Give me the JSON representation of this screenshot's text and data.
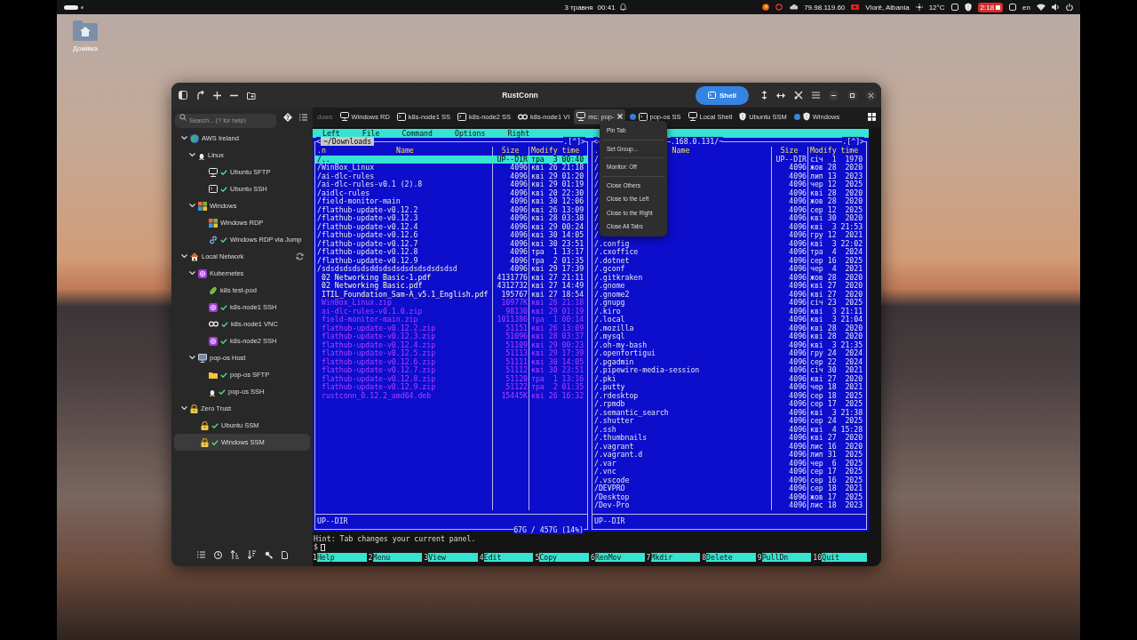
{
  "top_bar": {
    "date": "3 травня",
    "time": "00:41",
    "ip": "79.98.119.60",
    "location": "Vlorë, Albania",
    "temperature": "12°C",
    "badge": "2:18",
    "language": "en"
  },
  "desktop_icons": [
    {
      "label": "Домівка"
    }
  ],
  "window": {
    "title": "RustConn",
    "shell_button": "Shell"
  },
  "sidebar": {
    "search": {
      "placeholder": "Search... (? for help)"
    },
    "tree": [
      {
        "label": "AWS Ireland",
        "kind": "globe",
        "expanded": true,
        "sync": false,
        "selected": false,
        "children": [
          {
            "label": "Linux",
            "kind": "linux",
            "expanded": true,
            "selected": false,
            "children": [
              {
                "label": "Ubuntu SFTP",
                "kind": "sftp",
                "connected": true,
                "selected": false
              },
              {
                "label": "Ubuntu SSH",
                "kind": "ssh",
                "connected": true,
                "selected": false
              }
            ]
          },
          {
            "label": "Windows",
            "kind": "windows",
            "expanded": true,
            "selected": false,
            "children": [
              {
                "label": "Windows RDP",
                "kind": "windows",
                "connected": false,
                "selected": false
              },
              {
                "label": "Windows RDP via Jump",
                "kind": "link",
                "connected": true,
                "selected": false
              }
            ]
          }
        ]
      },
      {
        "label": "Local Network",
        "kind": "house",
        "expanded": true,
        "sync": true,
        "selected": false,
        "children": [
          {
            "label": "Kubernetes",
            "kind": "kube",
            "expanded": true,
            "selected": false,
            "children": [
              {
                "label": "k8s test-pod",
                "kind": "pod",
                "connected": false,
                "selected": false
              },
              {
                "label": "k8s-node1 SSH",
                "kind": "kube",
                "connected": true,
                "selected": false
              },
              {
                "label": "k8s-node1 VNC",
                "kind": "vnc",
                "connected": true,
                "selected": false
              },
              {
                "label": "k8s-node2 SSH",
                "kind": "kube",
                "connected": true,
                "selected": false
              }
            ]
          },
          {
            "label": "pop-os Host",
            "kind": "monitor",
            "expanded": true,
            "selected": false,
            "children": [
              {
                "label": "pop-os SFTP",
                "kind": "folder",
                "connected": true,
                "selected": false
              },
              {
                "label": "pop-os SSH",
                "kind": "linux",
                "connected": true,
                "selected": false
              }
            ]
          }
        ]
      },
      {
        "label": "Zero Trust",
        "kind": "lock",
        "expanded": true,
        "sync": false,
        "selected": false,
        "children": [
          {
            "label": "Ubuntu SSM",
            "kind": "lock",
            "connected": true,
            "selected": false
          },
          {
            "label": "Windows SSM",
            "kind": "lock",
            "connected": true,
            "selected": true
          }
        ]
      }
    ]
  },
  "tabs": [
    {
      "label": "dows",
      "kind": "none",
      "dot": false,
      "selected": false
    },
    {
      "label": "Windows RD",
      "kind": "rdp",
      "dot": false,
      "selected": false
    },
    {
      "label": "k8s-node1 SS",
      "kind": "ssh",
      "dot": false,
      "selected": false
    },
    {
      "label": "k8s-node2 SS",
      "kind": "ssh",
      "dot": false,
      "selected": false
    },
    {
      "label": "k8s-node1 VI",
      "kind": "vnc",
      "dot": false,
      "selected": false
    },
    {
      "label": "mc: pop-",
      "kind": "sftp",
      "dot": false,
      "selected": true
    },
    {
      "label": "pop-os SS",
      "kind": "ssh",
      "dot": true,
      "selected": false
    },
    {
      "label": "Local Shell",
      "kind": "sftp",
      "dot": false,
      "selected": false
    },
    {
      "label": "Ubuntu SSM",
      "kind": "ssm",
      "dot": false,
      "selected": false
    },
    {
      "label": "Windows",
      "kind": "ssm",
      "dot": true,
      "selected": false
    }
  ],
  "tab_menu": {
    "groups": [
      [
        "Pin Tab"
      ],
      [
        "Set Group..."
      ],
      [
        "Monitor: Off"
      ],
      [
        "Close Others",
        "Close to the Left",
        "Close to the Right",
        "Close All Tabs"
      ]
    ]
  },
  "terminal": {
    "menu": [
      "Left",
      "File",
      "Command",
      "Options",
      "Right"
    ],
    "panels": [
      {
        "active": true,
        "left_mark": "<",
        "path": "~/Downloads",
        "right_mark": ".[^]>",
        "columns": [
          ".n",
          "Name",
          "Size",
          "Modify time"
        ],
        "mini_status": "UP--DIR",
        "disk": "67G / 457G (14%)",
        "rows": [
          {
            "name": "/..",
            "size": "UP--DIR",
            "time": "тра  3 00:40",
            "kind": "dir",
            "selected": true
          },
          {
            "name": "/WinBox_Linux",
            "size": "4096",
            "time": "кві 26 21:18",
            "kind": "dir",
            "selected": false
          },
          {
            "name": "/ai-dlc-rules",
            "size": "4096",
            "time": "кві 29 01:20",
            "kind": "dir",
            "selected": false
          },
          {
            "name": "/ai-dlc-rules-v0.1 (2).8",
            "size": "4096",
            "time": "кві 29 01:19",
            "kind": "dir",
            "selected": false
          },
          {
            "name": "/aidlc-rules",
            "size": "4096",
            "time": "кві 20 22:30",
            "kind": "dir",
            "selected": false
          },
          {
            "name": "/field-monitor-main",
            "size": "4096",
            "time": "кві 30 12:06",
            "kind": "dir",
            "selected": false
          },
          {
            "name": "/flathub-update-v0.12.2",
            "size": "4096",
            "time": "кві 26 13:09",
            "kind": "dir",
            "selected": false
          },
          {
            "name": "/flathub-update-v0.12.3",
            "size": "4096",
            "time": "кві 28 03:38",
            "kind": "dir",
            "selected": false
          },
          {
            "name": "/flathub-update-v0.12.4",
            "size": "4096",
            "time": "кві 29 00:24",
            "kind": "dir",
            "selected": false
          },
          {
            "name": "/flathub-update-v0.12.6",
            "size": "4096",
            "time": "кві 30 14:05",
            "kind": "dir",
            "selected": false
          },
          {
            "name": "/flathub-update-v0.12.7",
            "size": "4096",
            "time": "кві 30 23:51",
            "kind": "dir",
            "selected": false
          },
          {
            "name": "/flathub-update-v0.12.8",
            "size": "4096",
            "time": "тра  1 13:17",
            "kind": "dir",
            "selected": false
          },
          {
            "name": "/flathub-update-v0.12.9",
            "size": "4096",
            "time": "тра  2 01:35",
            "kind": "dir",
            "selected": false
          },
          {
            "name": "/sdsdsdsdsdsddsdsdsdsdsdsdsdsdsd",
            "size": "4096",
            "time": "кві 29 17:39",
            "kind": "dir",
            "selected": false
          },
          {
            "name": "02 Networking Basic-1.pdf",
            "size": "4131776",
            "time": "кві 27 21:11",
            "kind": "file",
            "selected": false
          },
          {
            "name": "02 Networking Basic.pdf",
            "size": "4312732",
            "time": "кві 27 14:49",
            "kind": "file",
            "selected": false
          },
          {
            "name": "ITIL_Foundation_Sam-A_v5.1_English.pdf",
            "size": "195767",
            "time": "кві 27 18:54",
            "kind": "file",
            "selected": false
          },
          {
            "name": "WinBox_Linux.zip",
            "size": "10977K",
            "time": "кві 26 21:18",
            "kind": "archive",
            "selected": false
          },
          {
            "name": "ai-dlc-rules-v0.1.0.zip",
            "size": "98130",
            "time": "кві 29 01:19",
            "kind": "archive",
            "selected": false
          },
          {
            "name": "field-monitor-main.zip",
            "size": "1011386",
            "time": "тра  1 00:14",
            "kind": "archive",
            "selected": false
          },
          {
            "name": "flathub-update-v0.12.2.zip",
            "size": "51151",
            "time": "кві 26 13:09",
            "kind": "archive",
            "selected": false
          },
          {
            "name": "flathub-update-v0.12.3.zip",
            "size": "51096",
            "time": "кві 28 03:37",
            "kind": "archive",
            "selected": false
          },
          {
            "name": "flathub-update-v0.12.4.zip",
            "size": "51109",
            "time": "кві 29 00:23",
            "kind": "archive",
            "selected": false
          },
          {
            "name": "flathub-update-v0.12.5.zip",
            "size": "51113",
            "time": "кві 29 17:39",
            "kind": "archive",
            "selected": false
          },
          {
            "name": "flathub-update-v0.12.6.zip",
            "size": "51111",
            "time": "кві 30 14:05",
            "kind": "archive",
            "selected": false
          },
          {
            "name": "flathub-update-v0.12.7.zip",
            "size": "51112",
            "time": "кві 30 23:51",
            "kind": "archive",
            "selected": false
          },
          {
            "name": "flathub-update-v0.12.8.zip",
            "size": "51120",
            "time": "тра  1 13:16",
            "kind": "archive",
            "selected": false
          },
          {
            "name": "flathub-update-v0.12.9.zip",
            "size": "51122",
            "time": "тра  2 01:35",
            "kind": "archive",
            "selected": false
          },
          {
            "name": "rustconn_0.12.2_amd64.deb",
            "size": "15445K",
            "time": "кві 26 16:32",
            "kind": "archive",
            "selected": false
          }
        ]
      },
      {
        "active": false,
        "left_mark": "<",
        "path": ".168.0.131/~",
        "right_mark": ".[^]>",
        "columns": [
          ".",
          "Name",
          "Size",
          "Modify time"
        ],
        "mini_status": "UP--DIR",
        "rows": [
          {
            "name": "/",
            "size": "UP--DIR",
            "time": "січ  1  1970",
            "kind": "dir",
            "selected": false
          },
          {
            "name": "/",
            "size": "4096",
            "time": "жов 28  2020",
            "kind": "dir",
            "selected": false
          },
          {
            "name": "/",
            "size": "4096",
            "time": "лип 13  2023",
            "kind": "dir",
            "selected": false
          },
          {
            "name": "/",
            "size": "4096",
            "time": "чер 12  2025",
            "kind": "dir",
            "selected": false
          },
          {
            "name": "/",
            "size": "4096",
            "time": "кві 28  2020",
            "kind": "dir",
            "selected": false
          },
          {
            "name": "/",
            "size": "4096",
            "time": "жов 28  2020",
            "kind": "dir",
            "selected": false
          },
          {
            "name": "/",
            "size": "4096",
            "time": "сер 12  2025",
            "kind": "dir",
            "selected": false
          },
          {
            "name": "/",
            "size": "4096",
            "time": "кві 30  2020",
            "kind": "dir",
            "selected": false
          },
          {
            "name": "/",
            "size": "4096",
            "time": "кві  3 21:53",
            "kind": "dir",
            "selected": false
          },
          {
            "name": "/",
            "size": "4096",
            "time": "гру 12  2021",
            "kind": "dir",
            "selected": false
          },
          {
            "name": "/.config",
            "size": "4096",
            "time": "кві  3 22:02",
            "kind": "dir",
            "selected": false
          },
          {
            "name": "/.cxoffice",
            "size": "4096",
            "time": "тра  4  2024",
            "kind": "dir",
            "selected": false
          },
          {
            "name": "/.dotnet",
            "size": "4096",
            "time": "сер 16  2025",
            "kind": "dir",
            "selected": false
          },
          {
            "name": "/.gconf",
            "size": "4096",
            "time": "чер  4  2021",
            "kind": "dir",
            "selected": false
          },
          {
            "name": "/.gitkraken",
            "size": "4096",
            "time": "жов 28  2020",
            "kind": "dir",
            "selected": false
          },
          {
            "name": "/.gnome",
            "size": "4096",
            "time": "кві 27  2020",
            "kind": "dir",
            "selected": false
          },
          {
            "name": "/.gnome2",
            "size": "4096",
            "time": "кві 27  2020",
            "kind": "dir",
            "selected": false
          },
          {
            "name": "/.gnupg",
            "size": "4096",
            "time": "січ 23  2025",
            "kind": "dir",
            "selected": false
          },
          {
            "name": "/.kiro",
            "size": "4096",
            "time": "кві  3 21:11",
            "kind": "dir",
            "selected": false
          },
          {
            "name": "/.local",
            "size": "4096",
            "time": "кві  3 21:04",
            "kind": "dir",
            "selected": false
          },
          {
            "name": "/.mozilla",
            "size": "4096",
            "time": "кві 28  2020",
            "kind": "dir",
            "selected": false
          },
          {
            "name": "/.mysql",
            "size": "4096",
            "time": "кві 28  2020",
            "kind": "dir",
            "selected": false
          },
          {
            "name": "/.oh-my-bash",
            "size": "4096",
            "time": "кві  3 21:35",
            "kind": "dir",
            "selected": false
          },
          {
            "name": "/.openfortigui",
            "size": "4096",
            "time": "гру 24  2024",
            "kind": "dir",
            "selected": false
          },
          {
            "name": "/.pgadmin",
            "size": "4096",
            "time": "сер 22  2024",
            "kind": "dir",
            "selected": false
          },
          {
            "name": "/.pipewire-media-session",
            "size": "4096",
            "time": "січ 30  2021",
            "kind": "dir",
            "selected": false
          },
          {
            "name": "/.pki",
            "size": "4096",
            "time": "кві 27  2020",
            "kind": "dir",
            "selected": false
          },
          {
            "name": "/.putty",
            "size": "4096",
            "time": "чер 18  2021",
            "kind": "dir",
            "selected": false
          },
          {
            "name": "/.rdesktop",
            "size": "4096",
            "time": "сер 18  2025",
            "kind": "dir",
            "selected": false
          },
          {
            "name": "/.rpmdb",
            "size": "4096",
            "time": "сер 17  2025",
            "kind": "dir",
            "selected": false
          },
          {
            "name": "/.semantic_search",
            "size": "4096",
            "time": "кві  3 21:38",
            "kind": "dir",
            "selected": false
          },
          {
            "name": "/.shutter",
            "size": "4096",
            "time": "сер 24  2025",
            "kind": "dir",
            "selected": false
          },
          {
            "name": "/.ssh",
            "size": "4096",
            "time": "кві  4 15:28",
            "kind": "dir",
            "selected": false
          },
          {
            "name": "/.thumbnails",
            "size": "4096",
            "time": "кві 27  2020",
            "kind": "dir",
            "selected": false
          },
          {
            "name": "/.vagrant",
            "size": "4096",
            "time": "лис 16  2020",
            "kind": "dir",
            "selected": false
          },
          {
            "name": "/.vagrant.d",
            "size": "4096",
            "time": "лип 31  2025",
            "kind": "dir",
            "selected": false
          },
          {
            "name": "/.var",
            "size": "4096",
            "time": "чер  6  2025",
            "kind": "dir",
            "selected": false
          },
          {
            "name": "/.vnc",
            "size": "4096",
            "time": "сер 17  2025",
            "kind": "dir",
            "selected": false
          },
          {
            "name": "/.vscode",
            "size": "4096",
            "time": "сер 16  2025",
            "kind": "dir",
            "selected": false
          },
          {
            "name": "/DEVPRO",
            "size": "4096",
            "time": "сер 18  2021",
            "kind": "dir",
            "selected": false
          },
          {
            "name": "/Desktop",
            "size": "4096",
            "time": "жов 17  2025",
            "kind": "dir",
            "selected": false
          },
          {
            "name": "/Dev-Pro",
            "size": "4096",
            "time": "лис 18  2023",
            "kind": "dir",
            "selected": false
          }
        ]
      }
    ],
    "hint": "Hint: Tab changes your current panel.",
    "prompt": "$",
    "function_keys": [
      {
        "number": "1",
        "label": "Help"
      },
      {
        "number": "2",
        "label": "Menu"
      },
      {
        "number": "3",
        "label": "View"
      },
      {
        "number": "4",
        "label": "Edit"
      },
      {
        "number": "5",
        "label": "Copy"
      },
      {
        "number": "6",
        "label": "RenMov"
      },
      {
        "number": "7",
        "label": "Mkdir"
      },
      {
        "number": "8",
        "label": "Delete"
      },
      {
        "number": "9",
        "label": "PullDn"
      },
      {
        "number": "10",
        "label": "Quit"
      }
    ]
  }
}
